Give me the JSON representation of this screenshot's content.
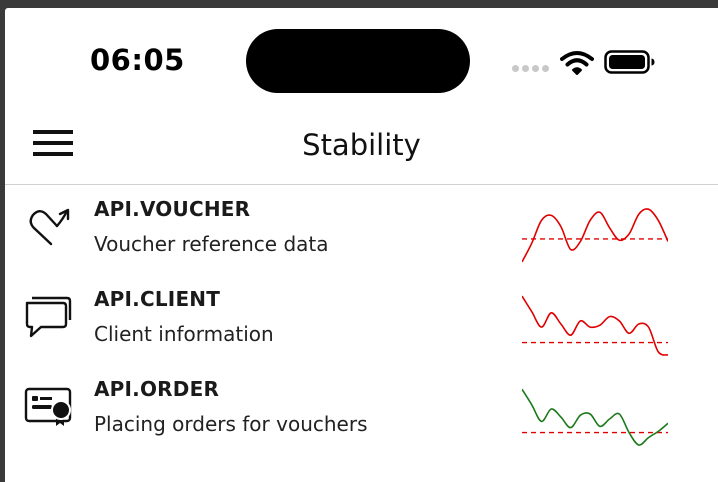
{
  "status_bar": {
    "time": "06:05"
  },
  "nav": {
    "title": "Stability"
  },
  "services": [
    {
      "name": "API.VOUCHER",
      "description": "Voucher reference data",
      "icon": "redo-arrow-icon",
      "status_color": "#e00000",
      "threshold": 0.42,
      "trend": [
        0.05,
        0.35,
        0.72,
        0.8,
        0.62,
        0.25,
        0.38,
        0.72,
        0.85,
        0.6,
        0.4,
        0.5,
        0.82,
        0.9,
        0.72,
        0.38
      ]
    },
    {
      "name": "API.CLIENT",
      "description": "Client information",
      "icon": "chat-bubbles-icon",
      "status_color": "#e00000",
      "threshold": 0.2,
      "trend": [
        0.95,
        0.7,
        0.45,
        0.68,
        0.5,
        0.32,
        0.55,
        0.45,
        0.48,
        0.62,
        0.55,
        0.35,
        0.5,
        0.45,
        0.05,
        0.0
      ]
    },
    {
      "name": "API.ORDER",
      "description": "Placing orders for vouchers",
      "icon": "certificate-card-icon",
      "status_color": "#1a7a1a",
      "threshold": 0.2,
      "trend": [
        0.9,
        0.65,
        0.38,
        0.58,
        0.45,
        0.28,
        0.48,
        0.5,
        0.3,
        0.42,
        0.5,
        0.2,
        0.0,
        0.12,
        0.22,
        0.35
      ]
    }
  ]
}
